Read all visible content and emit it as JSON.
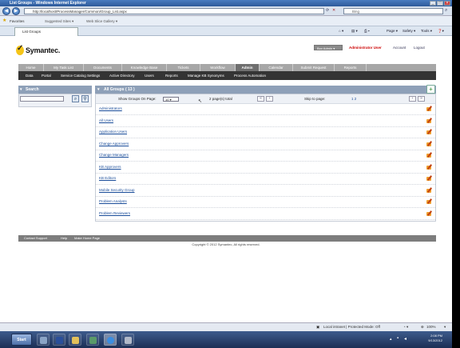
{
  "window": {
    "title": "List Groups - Windows Internet Explorer"
  },
  "browser": {
    "address": "http://localhost/ProcessManager/Common/Group_List.aspx",
    "search_placeholder": "Bing",
    "favorites_label": "Favorites",
    "fav_items": [
      "Suggested Sites ▾",
      "Web Slice Gallery ▾"
    ],
    "tab_title": "List Groups",
    "commands": [
      "Page ▾",
      "Safety ▾",
      "Tools ▾",
      "❓▾"
    ]
  },
  "header": {
    "brand": "Symantec.",
    "user_select": "Box Admin",
    "role_label": "Administrator User",
    "account_label": "Account",
    "logout_label": "Logout"
  },
  "nav_primary": [
    {
      "label": "Home",
      "active": false
    },
    {
      "label": "My Task List",
      "active": false
    },
    {
      "label": "Documents",
      "active": false
    },
    {
      "label": "Knowledge Base",
      "active": false
    },
    {
      "label": "Tickets",
      "active": false
    },
    {
      "label": "Workflow",
      "active": false
    },
    {
      "label": "Admin",
      "active": true
    },
    {
      "label": "Calendar",
      "active": false
    },
    {
      "label": "Submit Request",
      "active": false
    },
    {
      "label": "Reports",
      "active": false
    }
  ],
  "nav_secondary": [
    "Data",
    "Portal",
    "Service Catalog Settings",
    "Active Directory",
    "Users",
    "Reports",
    "Manage KB Synonyms",
    "Process Automation"
  ],
  "sidebar": {
    "title": "Search"
  },
  "groups": {
    "title": "All Groups ( 13 )",
    "show_label": "Show Groups On Page:",
    "per_page": "10",
    "pages_total": "2 page(s) total",
    "skip_label": "Skip to page:",
    "page_links": "1 2",
    "items": [
      "Administrators",
      "All Users",
      "Application Users",
      "Change Approvers",
      "Change Managers",
      "KB Approvers",
      "KB Editors",
      "Mobile Security Group",
      "Problem Analysts",
      "Problem Reviewers"
    ]
  },
  "footer": {
    "links": [
      "Contact Support",
      "Help",
      "Make Home Page"
    ],
    "copyright": "Copyright © 2012 Symantec, All rights reserved."
  },
  "status": {
    "zone": "Local intranet | Protected Mode: Off",
    "zoom": "100%"
  },
  "taskbar": {
    "start": "Start",
    "time": "2:08 PM",
    "date": "9/13/2012"
  }
}
